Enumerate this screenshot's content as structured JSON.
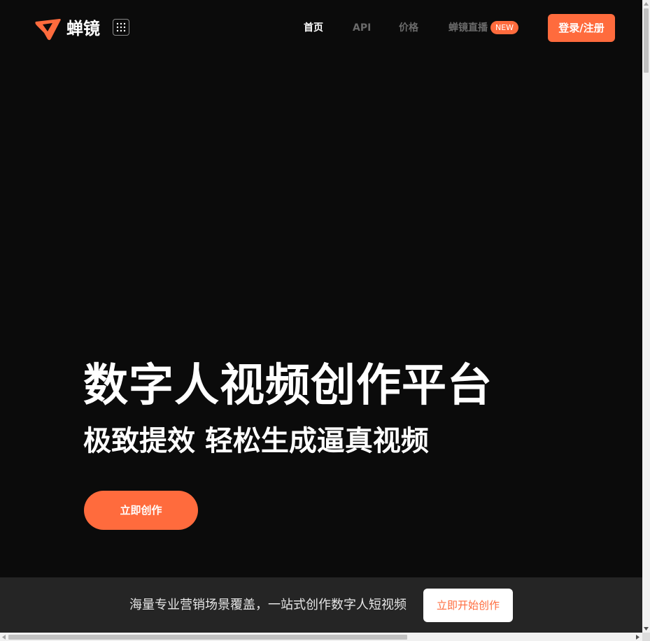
{
  "colors": {
    "accent": "#ff6b3d",
    "background": "#0b0b0b",
    "bottom_bar": "#252525",
    "nav_active": "#ffffff",
    "nav_inactive": "#6a6a6a"
  },
  "header": {
    "logo_text": "蝉镜",
    "apps_icon": "grid-dots-icon",
    "nav": [
      {
        "label": "首页",
        "active": true
      },
      {
        "label": "API",
        "active": false
      },
      {
        "label": "价格",
        "active": false
      },
      {
        "label": "蝉镜直播",
        "active": false
      }
    ],
    "badge": "NEW",
    "login_label": "登录/注册"
  },
  "hero": {
    "title": "数字人视频创作平台",
    "subtitle": "极致提效 轻松生成逼真视频",
    "cta_label": "立即创作"
  },
  "bottom_bar": {
    "text": "海量专业营销场景覆盖，一站式创作数字人短视频",
    "button_label": "立即开始创作"
  }
}
